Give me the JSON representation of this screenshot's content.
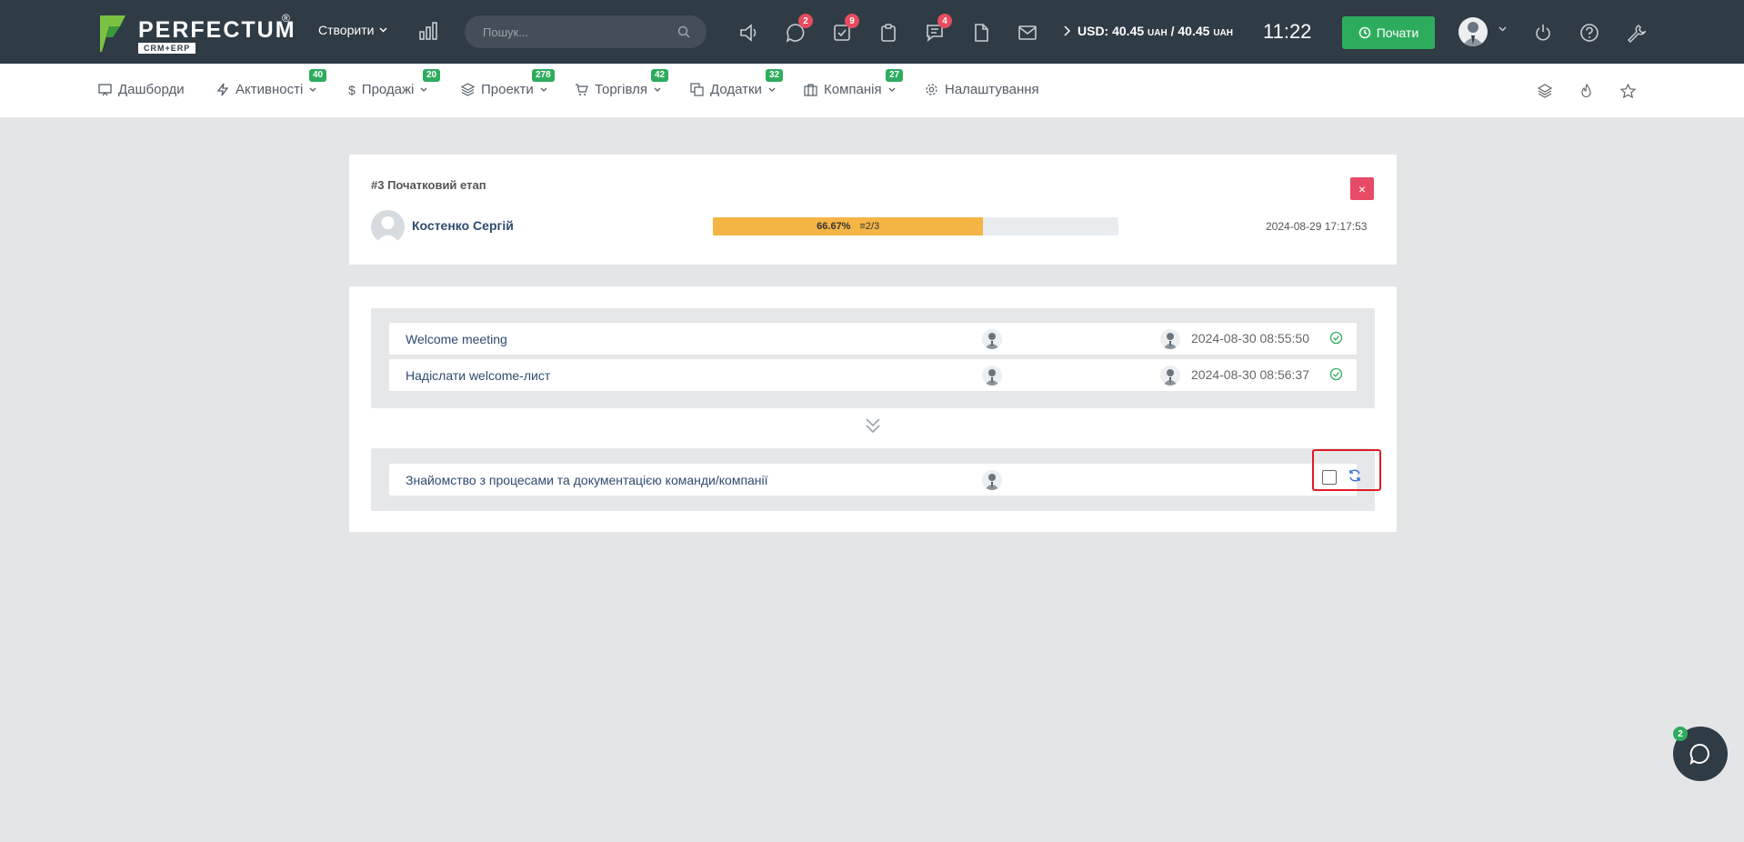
{
  "brand": {
    "name": "PERFECTUM",
    "registered": "®",
    "sub": "CRM+ERP"
  },
  "header": {
    "create_label": "Створити",
    "search_placeholder": "Пошук...",
    "badges": {
      "chat": "2",
      "tasks": "9",
      "messages": "4"
    },
    "currency": {
      "text": "USD: 40.45",
      "unit1": "UAH",
      "sep": "/ 40.45",
      "unit2": "UAH"
    },
    "time": "11:22",
    "start_label": "Почати"
  },
  "nav": {
    "items": [
      {
        "label": "Дашборди",
        "badge": ""
      },
      {
        "label": "Активності",
        "badge": "40"
      },
      {
        "label": "Продажі",
        "badge": "20"
      },
      {
        "label": "Проекти",
        "badge": "278"
      },
      {
        "label": "Торгівля",
        "badge": "42"
      },
      {
        "label": "Додатки",
        "badge": "32"
      },
      {
        "label": "Компанія",
        "badge": "27"
      },
      {
        "label": "Налаштування",
        "badge": ""
      }
    ]
  },
  "stage": {
    "title": "#3 Початковий етап",
    "close": "×",
    "user": "Костенко Сергій",
    "progress_percent": 66.67,
    "progress_label": "66.67%",
    "progress_count": "2/3",
    "date": "2024-08-29 17:17:53"
  },
  "tasks": {
    "completed": [
      {
        "name": "Welcome meeting",
        "date": "2024-08-30 08:55:50"
      },
      {
        "name": "Надіслати welcome-лист",
        "date": "2024-08-30 08:56:37"
      }
    ],
    "pending": [
      {
        "name": "Знайомство з процесами та документацією команди/компанії"
      }
    ]
  },
  "chat_badge": "2",
  "colors": {
    "topbar": "#2f3b45",
    "accent_green": "#2eac5e",
    "badge_red": "#e74c5e",
    "progress": "#f4b545",
    "highlight": "#e01b24"
  }
}
